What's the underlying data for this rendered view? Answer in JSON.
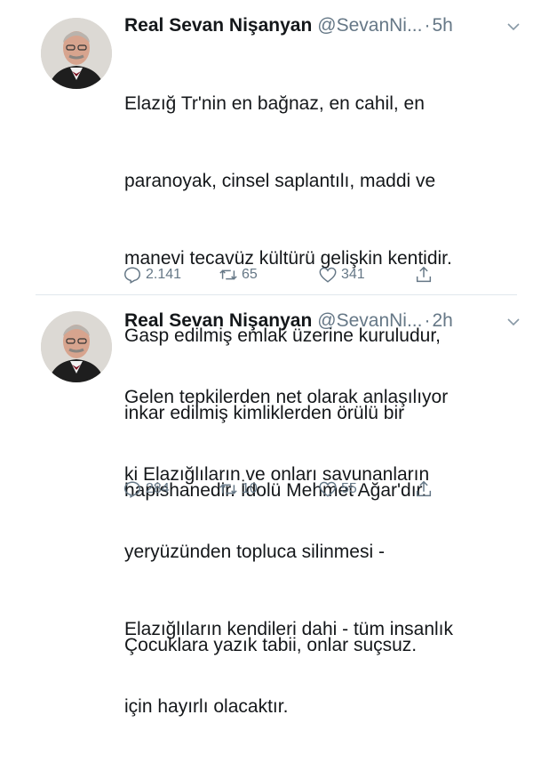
{
  "tweets": [
    {
      "name": "Real Sevan Nişanyan",
      "handle": "@SevanNi...",
      "separator": "·",
      "time": "5h",
      "lines": [
        "Elazığ Tr'nin en bağnaz, en cahil, en",
        "paranoyak, cinsel saplantılı, maddi ve",
        "manevi tecavüz kültürü gelişkin kentidir.",
        "Gasp edilmiş emlak üzerine kuruludur,",
        "inkar edilmiş kimliklerden örülü bir",
        "hapishanedir. İdolü Mehmet Ağar'dır.",
        "",
        "Çocuklara yazık tabii, onlar suçsuz."
      ],
      "replies": "2.141",
      "retweets": "65",
      "likes": "341"
    },
    {
      "name": "Real Sevan Nişanyan",
      "handle": "@SevanNi...",
      "separator": "·",
      "time": "2h",
      "lines": [
        "Gelen tepkilerden net olarak anlaşılıyor",
        "ki Elazığlıların ve onları savunanların",
        "yeryüzünden topluca silinmesi -",
        "Elazığlıların kendileri dahi - tüm insanlık",
        "için hayırlı olacaktır."
      ],
      "replies": "284",
      "retweets": "10",
      "likes": "55"
    }
  ],
  "icons": {
    "reply": "reply-icon",
    "retweet": "retweet-icon",
    "like": "heart-icon",
    "share": "share-icon",
    "caret": "chevron-down-icon"
  },
  "colors": {
    "text": "#14171a",
    "secondary": "#657786",
    "divider": "#e1e8ed"
  }
}
